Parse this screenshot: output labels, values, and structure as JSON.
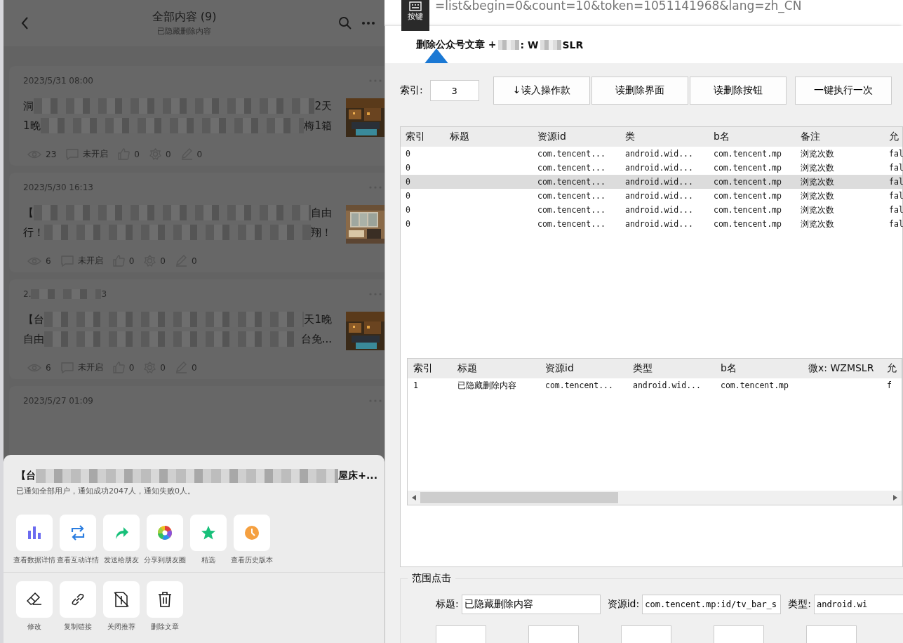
{
  "phone": {
    "title": "全部内容 (9)",
    "subtitle": "已隐藏删除内容",
    "articles": [
      {
        "date": [
          "2023/5/31 08:00"
        ],
        "title_lines": [
          [
            "洞",
            "2天"
          ],
          [
            "1晚",
            "梅1箱"
          ]
        ],
        "stats": [
          "23",
          "未开启",
          "0",
          "0",
          "0"
        ]
      },
      {
        "date": [
          "2023/5/30 16:13"
        ],
        "title_lines": [
          [
            "【",
            "自由"
          ],
          [
            "行！",
            "翔！"
          ]
        ],
        "stats": [
          "6",
          "未开启",
          "0",
          "0",
          "0"
        ]
      },
      {
        "date": [
          "2.",
          "3"
        ],
        "title_lines": [
          [
            "【台",
            "天1晚"
          ],
          [
            "自由",
            "台免..."
          ]
        ],
        "stats": [
          "6",
          "未开启",
          "0",
          "0",
          "0"
        ]
      },
      {
        "date": [
          "2023/5/27 01:09"
        ]
      }
    ],
    "sheet": {
      "title": [
        "【台",
        "屋床+..."
      ],
      "notice": "已通知全部用户，通知成功2047人，通知失败0人。",
      "action_rows": [
        [
          {
            "kind": "chart",
            "label": "查看数据详情"
          },
          {
            "kind": "repeat",
            "label": "查看互动详情"
          },
          {
            "kind": "share",
            "label": "发送给朋友"
          },
          {
            "kind": "aperture",
            "label": "分享到朋友圈"
          },
          {
            "kind": "star",
            "label": "精选"
          },
          {
            "kind": "clock",
            "label": "查看历史版本"
          }
        ],
        [
          {
            "kind": "eraser",
            "label": "修改"
          },
          {
            "kind": "link",
            "label": "复制链接"
          },
          {
            "kind": "nodoc",
            "label": "关闭推荐"
          },
          {
            "kind": "trash",
            "label": "删除文章"
          }
        ]
      ]
    }
  },
  "browser": {
    "url": "=list&begin=0&count=10&token=1051141968&lang=zh_CN",
    "tile_label": "按键"
  },
  "tool": {
    "title": [
      "删除公众号文章  +",
      ":  W",
      "SLR"
    ],
    "index_label": "索引:",
    "index_value": "3",
    "buttons": [
      "↓读入操作款",
      "读删除界面",
      "读删除按钮",
      "一键执行一次"
    ],
    "table": {
      "columns": [
        "索引",
        "标题",
        "资源id",
        "类",
        "b名",
        "备注",
        "允"
      ],
      "rows": [
        {
          "selected": false,
          "cells": [
            "0",
            "",
            "com.tencent...",
            "android.wid...",
            "com.tencent.mp",
            "浏览次数",
            "fal"
          ]
        },
        {
          "selected": false,
          "cells": [
            "0",
            "",
            "com.tencent...",
            "android.wid...",
            "com.tencent.mp",
            "浏览次数",
            "fal"
          ]
        },
        {
          "selected": true,
          "cells": [
            "0",
            "",
            "com.tencent...",
            "android.wid...",
            "com.tencent.mp",
            "浏览次数",
            "fal"
          ]
        },
        {
          "selected": false,
          "cells": [
            "0",
            "",
            "com.tencent...",
            "android.wid...",
            "com.tencent.mp",
            "浏览次数",
            "fal"
          ]
        },
        {
          "selected": false,
          "cells": [
            "0",
            "",
            "com.tencent...",
            "android.wid...",
            "com.tencent.mp",
            "浏览次数",
            "fal"
          ]
        },
        {
          "selected": false,
          "cells": [
            "0",
            "",
            "com.tencent...",
            "android.wid...",
            "com.tencent.mp",
            "浏览次数",
            "fal"
          ]
        }
      ]
    },
    "table2": {
      "columns": [
        "索引",
        "标题",
        "资源id",
        "类型",
        "b名",
        "微x: WZMSLR",
        "允"
      ],
      "rows": [
        {
          "selected": false,
          "cells": [
            "1",
            "已隐藏删除内容",
            "com.tencent...",
            "android.wid...",
            "com.tencent.mp",
            "",
            "f"
          ]
        }
      ]
    },
    "group": {
      "title": "范围点击",
      "fields": [
        {
          "label": "标题:",
          "value": "已隐藏删除内容"
        },
        {
          "label": "资源id:",
          "value": "com.tencent.mp:id/tv_bar_s"
        },
        {
          "label": "类型:",
          "value": "android.wi"
        }
      ]
    }
  }
}
